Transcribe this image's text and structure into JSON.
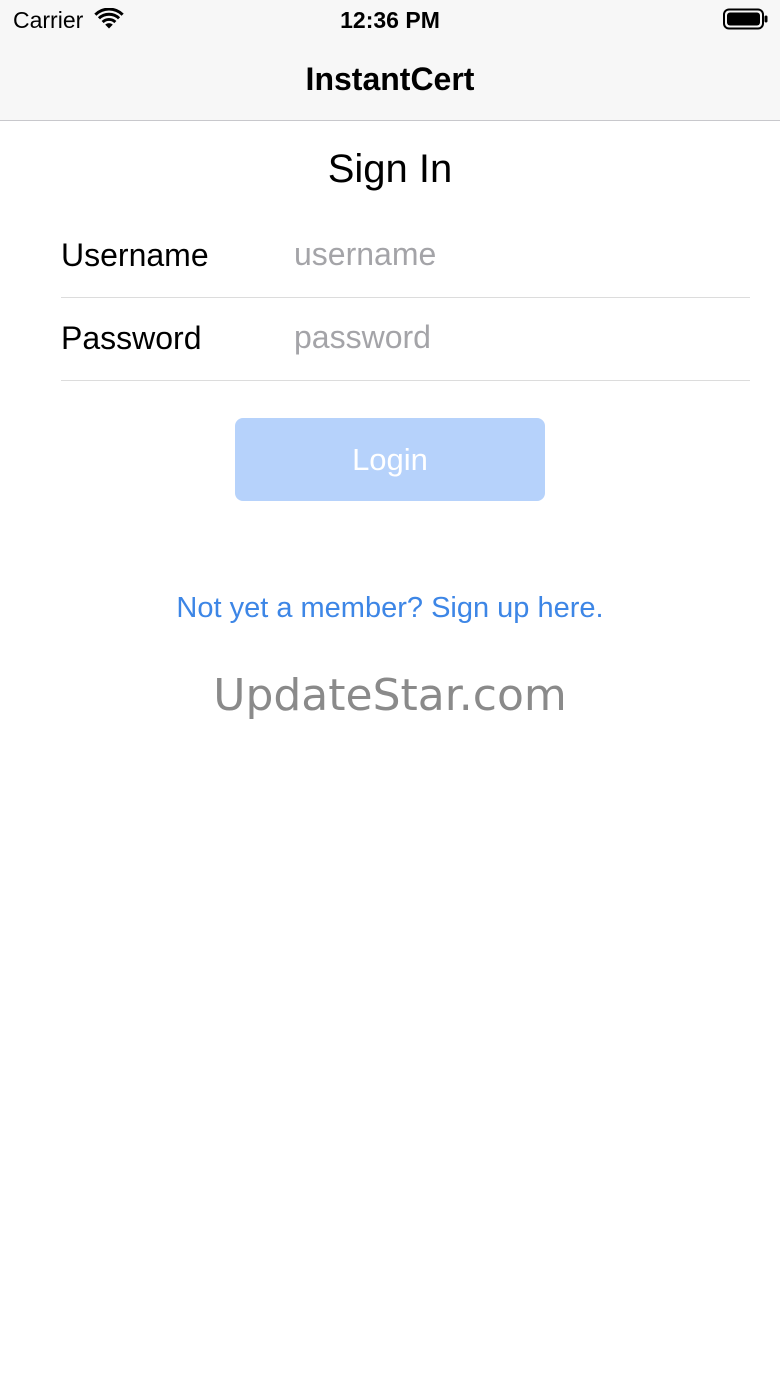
{
  "status_bar": {
    "carrier": "Carrier",
    "time": "12:36 PM",
    "icons": [
      "wifi-icon",
      "battery-icon"
    ]
  },
  "nav": {
    "title": "InstantCert"
  },
  "form": {
    "heading": "Sign In",
    "username_label": "Username",
    "username_value": "",
    "username_placeholder": "username",
    "password_label": "Password",
    "password_value": "",
    "password_placeholder": "password",
    "login_label": "Login"
  },
  "signup_link": "Not yet a member? Sign up here.",
  "watermark": "UpdateStar.com",
  "colors": {
    "bar_background": "#f7f7f7",
    "login_button": "#b6d2fb",
    "link": "#3d86e6",
    "placeholder": "#a4a4a8",
    "watermark": "#8a8a8a"
  }
}
